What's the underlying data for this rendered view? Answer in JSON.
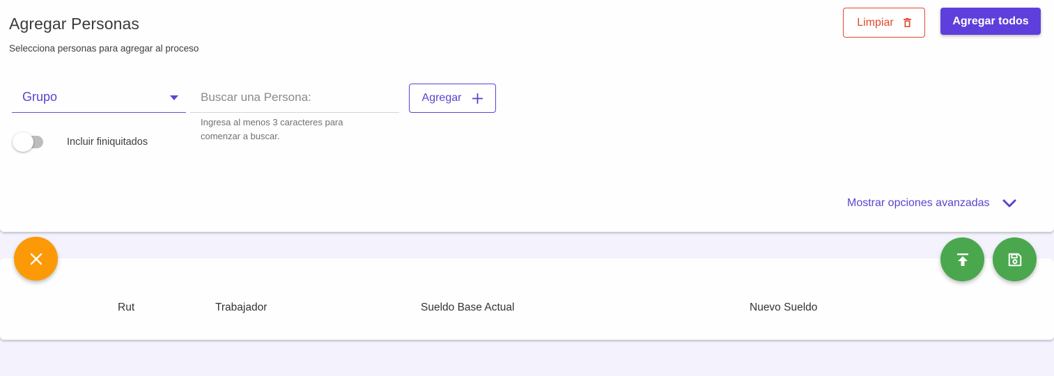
{
  "header": {
    "title": "Agregar Personas",
    "subtitle": "Selecciona personas para agregar al proceso",
    "clear_label": "Limpiar",
    "add_all_label": "Agregar todos"
  },
  "filters": {
    "group_select_value": "Grupo",
    "search_placeholder": "Buscar una Persona:",
    "search_hint": "Ingresa al menos 3 caracteres para comenzar a buscar.",
    "add_label": "Agregar",
    "toggle_label": "Incluir finiquitados",
    "toggle_on": false,
    "advanced_label": "Mostrar opciones avanzadas"
  },
  "table": {
    "columns": [
      "Rut",
      "Trabajador",
      "Sueldo Base Actual",
      "Nuevo Sueldo"
    ]
  },
  "colors": {
    "primary": "#5f3fdc",
    "danger": "#e0492b",
    "warning": "#fb9a06",
    "success": "#4aa74e",
    "background": "#f4f3fd"
  },
  "icons": {
    "clear": "trash-icon",
    "add": "plus-icon",
    "dropdown": "caret-down-icon",
    "advanced": "chevron-down-icon",
    "close": "close-icon",
    "upload": "upload-icon",
    "save": "save-icon"
  }
}
